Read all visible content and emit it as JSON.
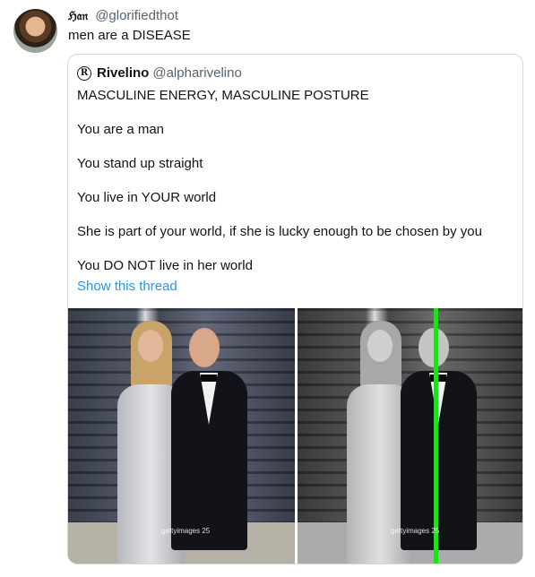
{
  "tweet": {
    "display_name": "ℌ𝔞𝔫",
    "handle": "@glorifiedthot",
    "text": "men are a DISEASE"
  },
  "quote": {
    "avatar_glyph": "R",
    "display_name": "Rivelino",
    "handle": "@alpharivelino",
    "lines": [
      "MASCULINE ENERGY, MASCULINE POSTURE",
      "You are a man",
      "You stand up straight",
      "You live in YOUR world",
      "She is part of your world, if she is lucky enough to be chosen by you",
      "You DO NOT live in her world"
    ],
    "show_thread": "Show this thread",
    "photos": [
      {
        "watermark": "gettyimages  25"
      },
      {
        "watermark": "gettyimages  25"
      }
    ]
  },
  "colors": {
    "link": "#1d9bf0",
    "secondary_text": "#536471",
    "border": "#cfd9de",
    "overlay_line": "#22dd22"
  }
}
